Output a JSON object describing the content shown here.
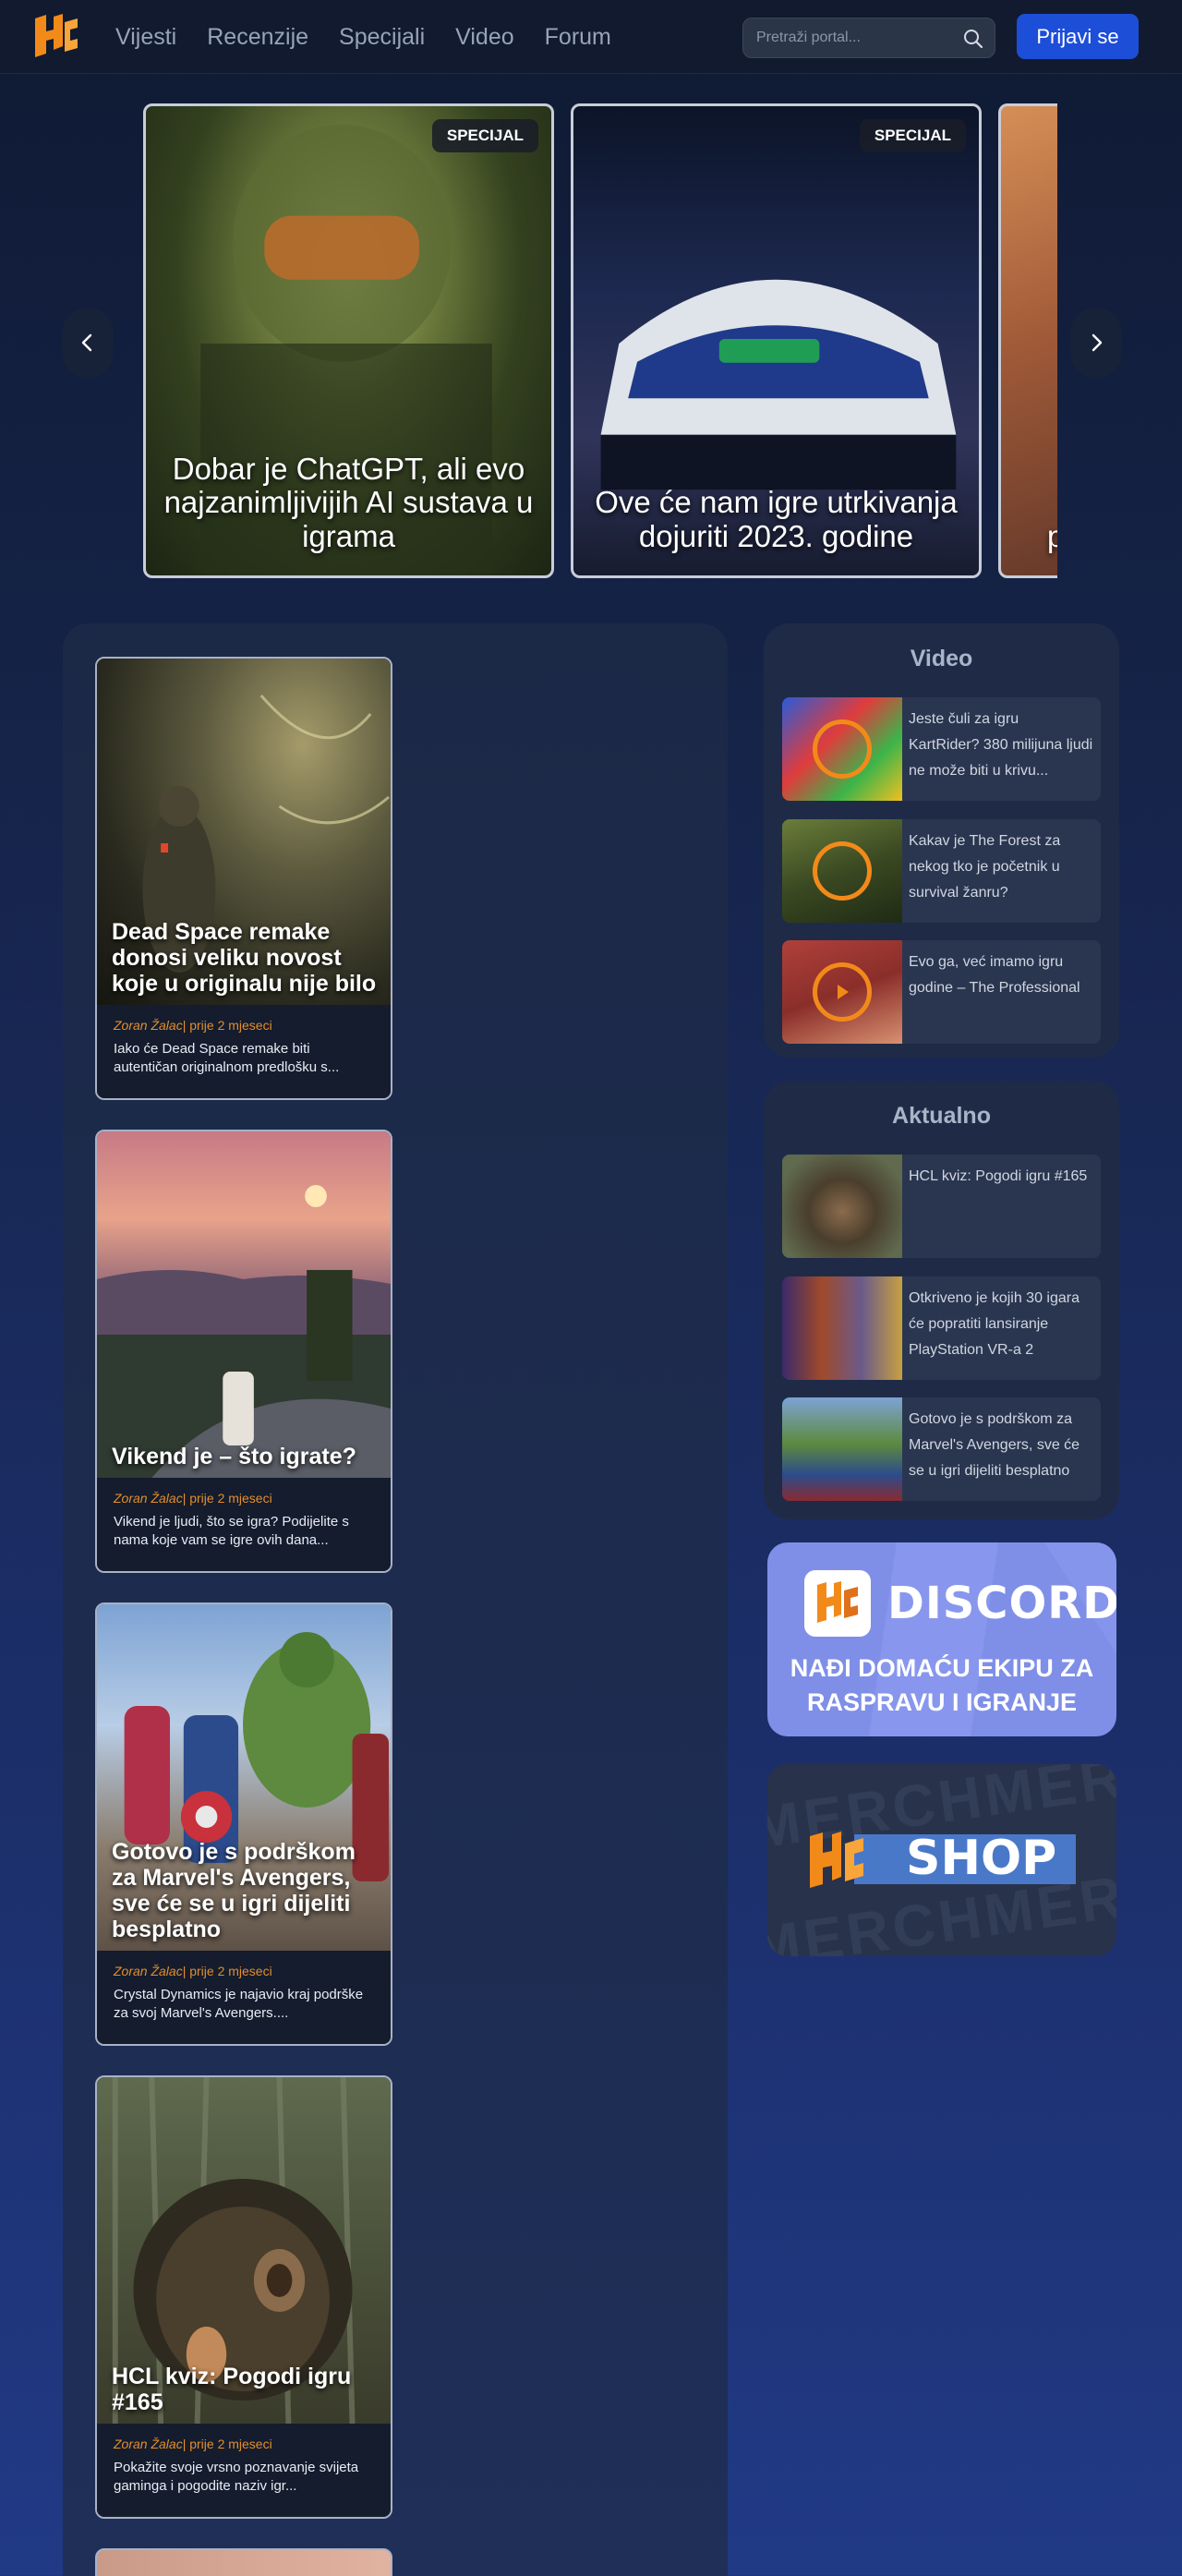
{
  "nav": {
    "links": [
      "Vijesti",
      "Recenzije",
      "Specijali",
      "Video",
      "Forum"
    ],
    "search_placeholder": "Pretraži portal...",
    "login_label": "Prijavi se"
  },
  "carousel": {
    "slides": [
      {
        "badge": "SPECIJAL",
        "title": "Dobar je ChatGPT, ali evo najzanimljivijih AI sustava u igrama"
      },
      {
        "badge": "SPECIJAL",
        "title": "Ove će nam igre utrkivanja dojuriti 2023. godine"
      },
      {
        "badge": "",
        "title": "p"
      }
    ]
  },
  "feed": {
    "articles": [
      {
        "title": "Dead Space remake donosi veliku novost koje u originalu nije bilo",
        "author": "Zoran Žalac",
        "time": "| prije 2 mjeseci",
        "description": "Iako će Dead Space remake biti autentičan originalnom predlošku s..."
      },
      {
        "title": "Vikend je – što igrate?",
        "author": "Zoran Žalac",
        "time": "| prije 2 mjeseci",
        "description": "Vikend je ljudi, što se igra? Podijelite s nama koje vam se igre ovih dana..."
      },
      {
        "title": "Gotovo je s podrškom za Marvel's Avengers, sve će se u igri dijeliti besplatno",
        "author": "Zoran Žalac",
        "time": "| prije 2 mjeseci",
        "description": "Crystal Dynamics je najavio kraj podrške za svoj Marvel's Avengers...."
      },
      {
        "title": "HCL kviz: Pogodi igru #165",
        "author": "Zoran Žalac",
        "time": "| prije 2 mjeseci",
        "description": "Pokažite svoje vrsno poznavanje svijeta gaminga i pogodite naziv igr..."
      }
    ]
  },
  "sidebar": {
    "video": {
      "title": "Video",
      "items": [
        "Jeste čuli za igru KartRider? 380 milijuna ljudi ne može biti u krivu...",
        "Kakav je The Forest za nekog tko je početnik u survival žanru?",
        "Evo ga, već imamo igru godine – The Professional"
      ]
    },
    "aktualno": {
      "title": "Aktualno",
      "items": [
        "HCL kviz: Pogodi igru #165",
        "Otkriveno je kojih 30 igara će popratiti lansiranje PlayStation VR-a 2",
        "Gotovo je s podrškom za Marvel's Avengers, sve će se u igri dijeliti besplatno"
      ]
    },
    "discord": {
      "brand": "DISCORD",
      "line1": "NAĐI DOMAĆU EKIPU ZA",
      "line2": "RASPRAVU I IGRANJE"
    },
    "shop": {
      "brand": "SHOP",
      "watermark": "MERCHMERCHME"
    }
  },
  "colors": {
    "accent": "#1d4ed8",
    "orange": "#f28a1a",
    "author": "#e38e2a"
  }
}
